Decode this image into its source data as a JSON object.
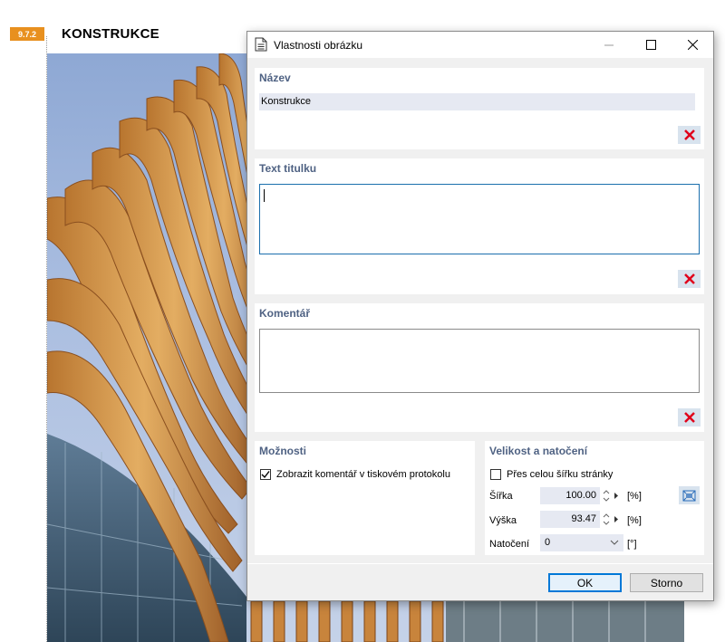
{
  "document": {
    "section_number": "9.7.2",
    "section_title": "KONSTRUKCE"
  },
  "dialog": {
    "title": "Vlastnosti obrázku",
    "name_group": {
      "title": "Název",
      "value": "Konstrukce"
    },
    "caption_group": {
      "title": "Text titulku",
      "value": ""
    },
    "comment_group": {
      "title": "Komentář",
      "value": ""
    },
    "options_group": {
      "title": "Možnosti",
      "show_comment_label": "Zobrazit komentář v tiskovém protokolu",
      "show_comment_checked": true
    },
    "size_group": {
      "title": "Velikost a natočení",
      "full_width_label": "Přes celou šířku stránky",
      "full_width_checked": false,
      "width_label": "Šířka",
      "width_value": "100.00",
      "width_unit": "[%]",
      "height_label": "Výška",
      "height_value": "93.47",
      "height_unit": "[%]",
      "rotation_label": "Natočení",
      "rotation_value": "0",
      "rotation_unit": "[°]"
    },
    "buttons": {
      "ok": "OK",
      "cancel": "Storno"
    }
  },
  "colors": {
    "accent_badge": "#e8901f",
    "group_title": "#4f6283",
    "focus_border": "#0078d7",
    "delete_icon": "#e0001b"
  },
  "icons": [
    "document-icon",
    "minimize-icon",
    "maximize-icon",
    "close-icon",
    "delete-x-icon",
    "checkmark-icon",
    "fit-size-icon"
  ]
}
